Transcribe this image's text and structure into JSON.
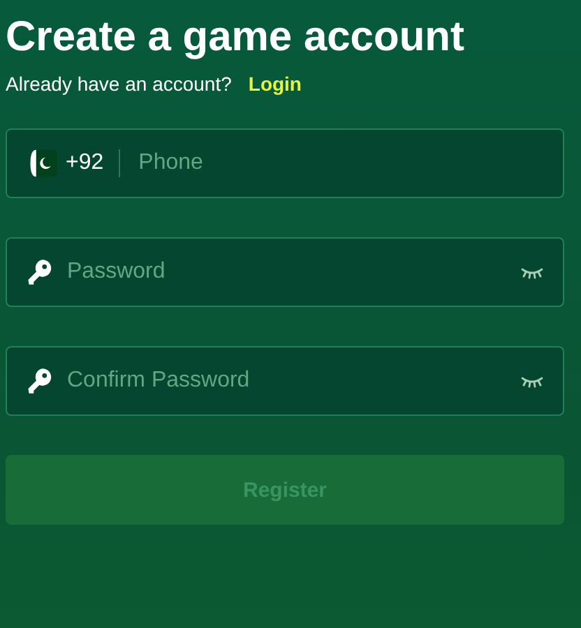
{
  "title": "Create a game account",
  "login_prompt": {
    "text": "Already have an account?",
    "link": "Login"
  },
  "fields": [
    {
      "kind": "phone",
      "country_code": "+92",
      "placeholder": "Phone"
    },
    {
      "kind": "password",
      "placeholder": "Password"
    },
    {
      "kind": "password",
      "placeholder": "Confirm Password"
    }
  ],
  "register_button": {
    "label": "Register",
    "disabled": true
  }
}
